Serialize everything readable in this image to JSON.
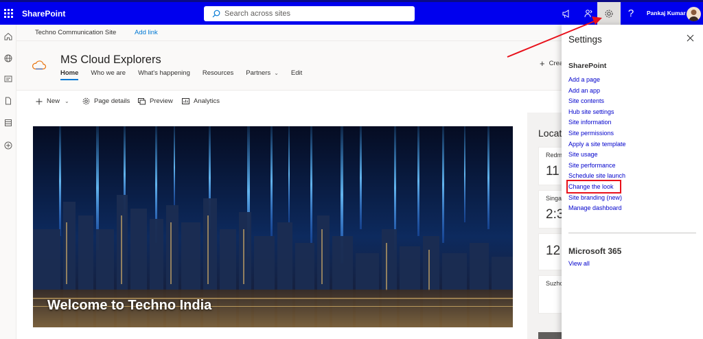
{
  "suite": {
    "app_name": "SharePoint",
    "search_placeholder": "Search across sites",
    "user_name": "Pankaj Kumar",
    "help_label": "?"
  },
  "hub_nav": {
    "site_title": "Techno Communication Site",
    "add_link": "Add link"
  },
  "site": {
    "title": "MS Cloud Explorers",
    "nav": [
      "Home",
      "Who we are",
      "What's happening",
      "Resources",
      "Partners",
      "Edit"
    ],
    "create_label": "Crea"
  },
  "command_bar": {
    "new": "New",
    "page_details": "Page details",
    "preview": "Preview",
    "analytics": "Analytics"
  },
  "hero": {
    "title": "Welcome to Techno India"
  },
  "locations": {
    "title": "Locatio",
    "cards": [
      {
        "city": "Redm",
        "time": "11"
      },
      {
        "city": "Singa",
        "time": "2:3"
      },
      {
        "city": "",
        "time": "12"
      },
      {
        "city": "Suzho",
        "time": ""
      }
    ]
  },
  "settings": {
    "title": "Settings",
    "section_sharepoint": "SharePoint",
    "links": [
      "Add a page",
      "Add an app",
      "Site contents",
      "Hub site settings",
      "Site information",
      "Site permissions",
      "Apply a site template",
      "Site usage",
      "Site performance",
      "Schedule site launch",
      "Change the look",
      "Site branding (new)",
      "Manage dashboard"
    ],
    "section_m365": "Microsoft 365",
    "view_all": "View all"
  },
  "colors": {
    "suite_bar": "#0000ee",
    "link": "#0000cc",
    "accent": "#0078d4",
    "annotation": "#e8101a"
  }
}
